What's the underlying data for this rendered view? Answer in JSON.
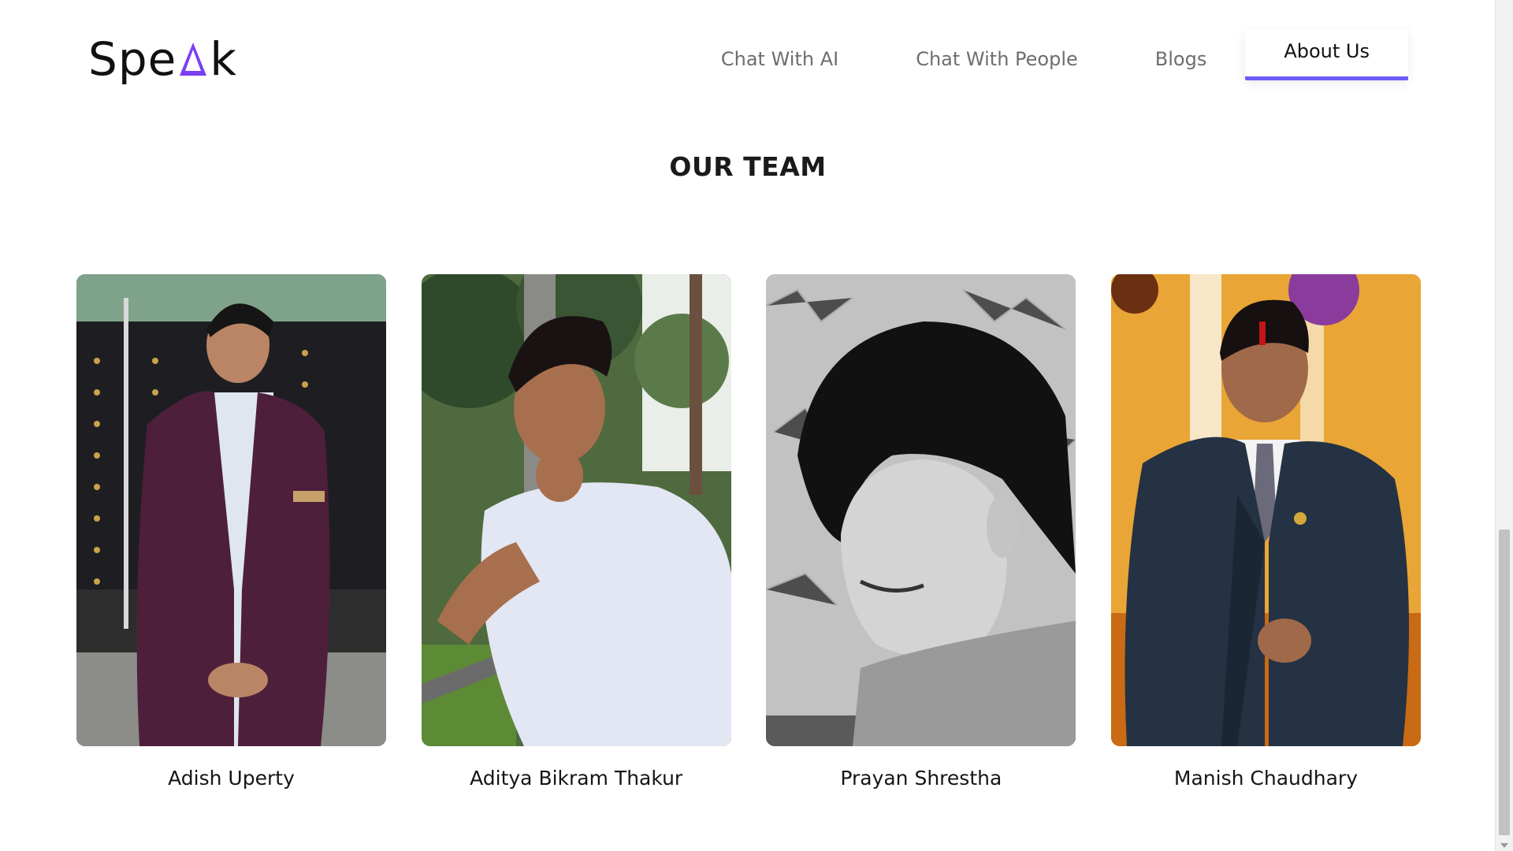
{
  "header": {
    "logo_prefix": "Spe",
    "logo_suffix": "k",
    "logo_accent_icon": "triangle-a-icon",
    "accent_color": "#7b3ff2",
    "nav": [
      {
        "label": "Chat With AI",
        "active": false
      },
      {
        "label": "Chat With People",
        "active": false
      },
      {
        "label": "Blogs",
        "active": false
      },
      {
        "label": "About Us",
        "active": true
      }
    ],
    "active_indicator_color": "#6b5cf6"
  },
  "section": {
    "title": "OUR TEAM"
  },
  "team": [
    {
      "name": "Adish Uperty"
    },
    {
      "name": "Aditya Bikram Thakur"
    },
    {
      "name": "Prayan Shrestha"
    },
    {
      "name": "Manish Chaudhary"
    }
  ]
}
